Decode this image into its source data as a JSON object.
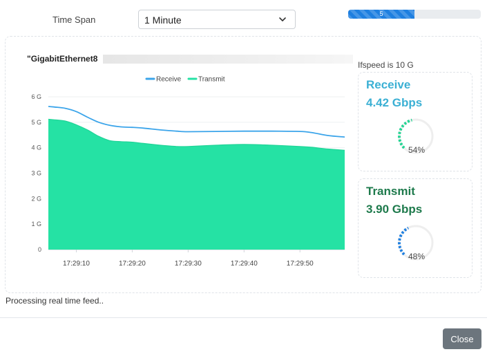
{
  "controls": {
    "timespan_label": "Time Span",
    "timespan_value": "1 Minute",
    "progress_text": "5",
    "progress_fraction": 0.5
  },
  "interface": {
    "name": "\"GigabitEthernet8",
    "ifspeed": "Ifspeed is 10 G"
  },
  "receive": {
    "title": "Receive",
    "rate": "4.42 Gbps",
    "percent_text": "54%",
    "percent": 54,
    "color": "#3bb0d4",
    "gauge_color": "#22d493"
  },
  "transmit": {
    "title": "Transmit",
    "rate": "3.90 Gbps",
    "percent_text": "48%",
    "percent": 48,
    "color": "#1e7a4c",
    "gauge_color": "#1e7fe0"
  },
  "status_text": "Processing real time feed..",
  "footer": {
    "close_label": "Close"
  },
  "chart_data": {
    "type": "area",
    "x": [
      "17:29:05",
      "17:29:06",
      "17:29:08",
      "17:29:10",
      "17:29:12",
      "17:29:14",
      "17:29:16",
      "17:29:18",
      "17:29:20",
      "17:29:22",
      "17:29:25",
      "17:29:28",
      "17:29:30",
      "17:29:35",
      "17:29:40",
      "17:29:45",
      "17:29:50",
      "17:29:52",
      "17:29:55",
      "17:29:58"
    ],
    "x_ticks": [
      "17:29:10",
      "17:29:20",
      "17:29:30",
      "17:29:40",
      "17:29:50"
    ],
    "y_ticks": [
      "0",
      "1 G",
      "2 G",
      "3 G",
      "4 G",
      "5 G",
      "6 G"
    ],
    "ylim": [
      0,
      6
    ],
    "series": [
      {
        "name": "Receive",
        "color": "#3aa4ea",
        "values": [
          5.62,
          5.6,
          5.55,
          5.42,
          5.2,
          5.0,
          4.88,
          4.82,
          4.8,
          4.77,
          4.7,
          4.65,
          4.63,
          4.64,
          4.65,
          4.65,
          4.64,
          4.6,
          4.48,
          4.42
        ]
      },
      {
        "name": "Transmit",
        "color": "#25e2a4",
        "values": [
          5.12,
          5.1,
          5.05,
          4.9,
          4.7,
          4.45,
          4.28,
          4.24,
          4.22,
          4.17,
          4.1,
          4.05,
          4.05,
          4.1,
          4.13,
          4.1,
          4.05,
          4.02,
          3.95,
          3.9
        ]
      }
    ],
    "grid": true,
    "legend": "top-center"
  }
}
